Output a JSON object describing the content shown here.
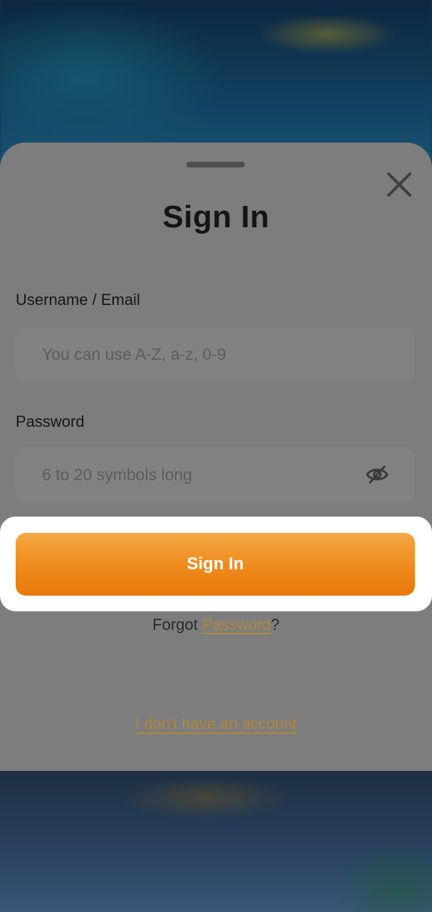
{
  "modal": {
    "title": "Sign In",
    "close_icon": "close-icon",
    "username": {
      "label": "Username / Email",
      "value": "",
      "placeholder": "You can use A-Z, a-z, 0-9"
    },
    "password": {
      "label": "Password",
      "value": "",
      "placeholder": "6 to 20 symbols long",
      "toggle_icon": "eye-off-icon"
    },
    "submit_label": "Sign In",
    "forgot": {
      "prefix": "Forgot ",
      "link": "Password",
      "suffix": "?"
    },
    "no_account_label": "I don't have an account"
  },
  "colors": {
    "accent_orange": "#ee8a1c",
    "link_gold": "#b0883e",
    "sheet_gray": "#7d7d7d"
  }
}
